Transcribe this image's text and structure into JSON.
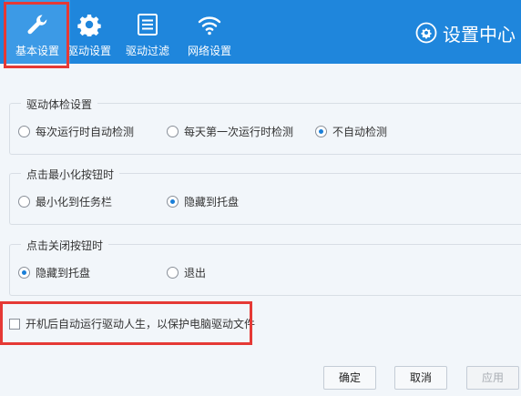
{
  "tabs": [
    {
      "label": "基本设置",
      "icon": "wrench-icon"
    },
    {
      "label": "驱动设置",
      "icon": "gear-icon"
    },
    {
      "label": "驱动过滤",
      "icon": "list-icon"
    },
    {
      "label": "网络设置",
      "icon": "wifi-icon"
    }
  ],
  "active_tab": 0,
  "brand": {
    "title": "设置中心",
    "icon": "settings-gear-icon"
  },
  "groups": {
    "check": {
      "title": "驱动体检设置",
      "options": [
        "每次运行时自动检测",
        "每天第一次运行时检测",
        "不自动检测"
      ],
      "selected": 2
    },
    "minimize": {
      "title": "点击最小化按钮时",
      "options": [
        "最小化到任务栏",
        "隐藏到托盘"
      ],
      "selected": 1
    },
    "close": {
      "title": "点击关闭按钮时",
      "options": [
        "隐藏到托盘",
        "退出"
      ],
      "selected": 0
    }
  },
  "autostart": {
    "label": "开机后自动运行驱动人生，以保护电脑驱动文件",
    "checked": false
  },
  "buttons": {
    "ok": "确定",
    "cancel": "取消",
    "apply": "应用"
  },
  "colors": {
    "topbar": "#1f86dc",
    "highlight": "#e53935",
    "radio_on": "#1a7fd8"
  }
}
